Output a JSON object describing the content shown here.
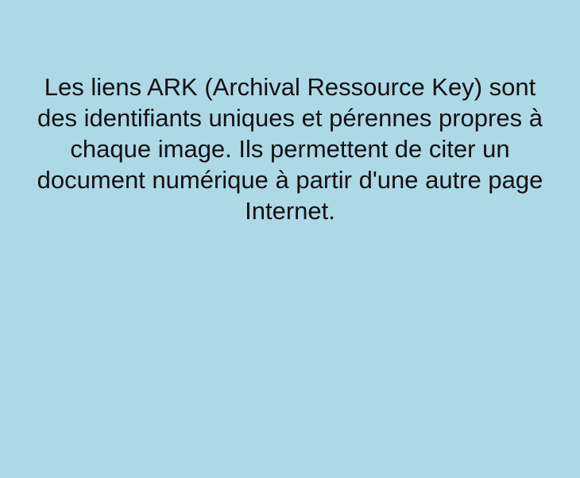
{
  "tooltip": {
    "text": "Les liens ARK (Archival Ressource Key) sont des identifiants uniques et pérennes propres à chaque image. Ils permettent de citer un document numérique à partir d'une autre page Internet."
  },
  "colors": {
    "background": "#add8e6",
    "text": "#111111"
  }
}
